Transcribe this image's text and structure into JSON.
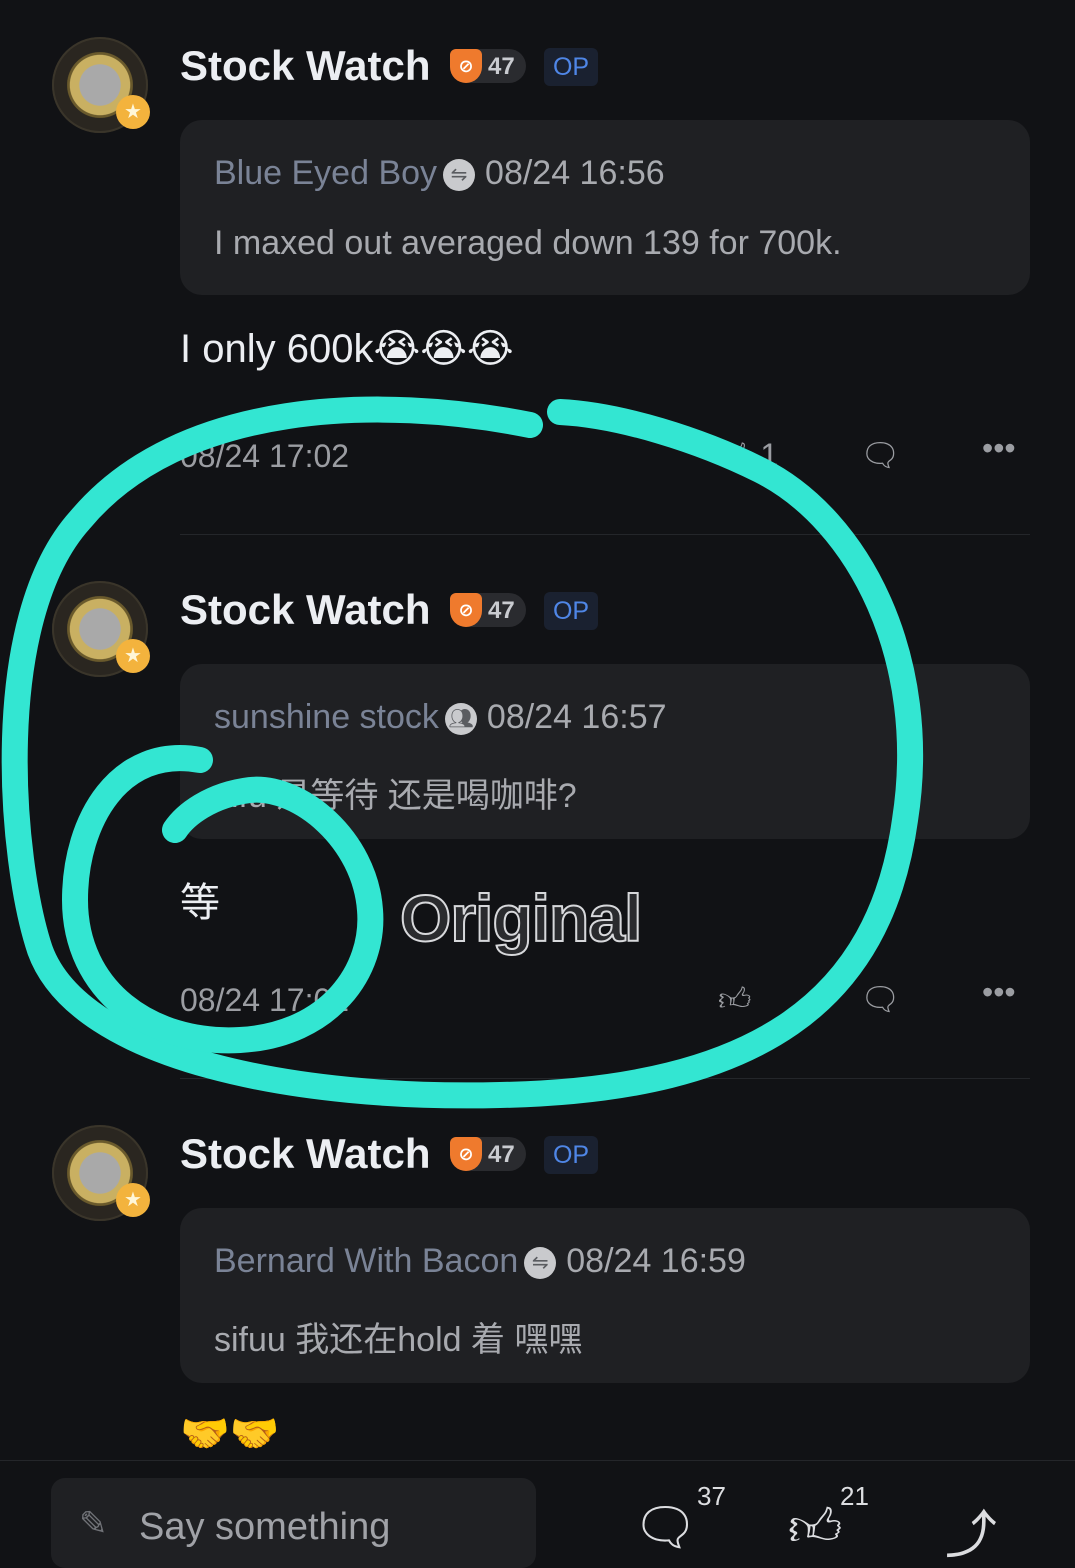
{
  "comments": [
    {
      "author": "Stock Watch",
      "level": "47",
      "op_badge": "OP",
      "quote": {
        "author": "Blue Eyed Boy",
        "time": "08/24 16:56",
        "text": "I maxed out averaged down 139 for 700k."
      },
      "text": "I only 600k😭😭😭",
      "time": "08/24 17:02",
      "likes": "1"
    },
    {
      "author": "Stock Watch",
      "level": "47",
      "op_badge": "OP",
      "quote": {
        "author": "sunshine stock",
        "time": "08/24 16:57",
        "text": "sifu 是等待 还是喝咖啡?"
      },
      "text": "等",
      "time": "08/24 17:02",
      "likes": ""
    },
    {
      "author": "Stock Watch",
      "level": "47",
      "op_badge": "OP",
      "quote": {
        "author": "Bernard With Bacon",
        "time": "08/24 16:59",
        "text": "sifuu 我还在hold 着 嘿嘿"
      },
      "text": "🤝🤝"
    }
  ],
  "annotation": {
    "label": "Original",
    "color": "#33e6d2"
  },
  "bottom_bar": {
    "placeholder": "Say something",
    "comment_count": "37",
    "like_count": "21"
  }
}
